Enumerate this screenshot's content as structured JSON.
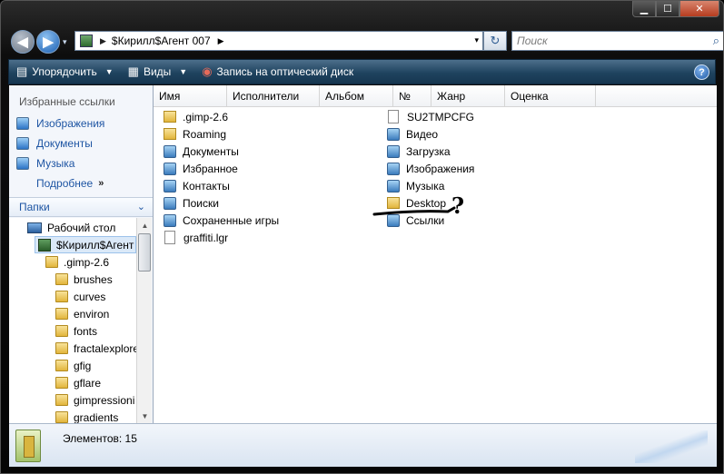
{
  "window": {
    "caption_buttons": {
      "minimize": "▁",
      "maximize": "☐",
      "close": "✕"
    }
  },
  "nav": {
    "back_glyph": "◀",
    "forward_glyph": "▶",
    "history_glyph": "▾"
  },
  "address": {
    "path": "$Кирилл$Агент 007",
    "separator_glyph": "▶",
    "dropdown_glyph": "▾"
  },
  "refresh": {
    "glyph": "↻"
  },
  "search": {
    "placeholder": "Поиск",
    "icon": "search-icon"
  },
  "toolbar": {
    "organize": "Упорядочить",
    "views": "Виды",
    "burn": "Запись на оптический диск",
    "help": "?",
    "chevron": "▼"
  },
  "favorites": {
    "header": "Избранные ссылки",
    "items": [
      {
        "label": "Изображения",
        "icon": "pictures-icon"
      },
      {
        "label": "Документы",
        "icon": "documents-icon"
      },
      {
        "label": "Музыка",
        "icon": "music-icon"
      }
    ],
    "more": "Подробнее",
    "more_chevron": "»"
  },
  "folders": {
    "header": "Папки",
    "chevron": "⌄",
    "tree": [
      {
        "label": "Рабочий стол",
        "type": "desktop"
      },
      {
        "label": "$Кирилл$Агент",
        "type": "user",
        "selected": true
      },
      {
        "label": ".gimp-2.6",
        "type": "folder"
      },
      {
        "label": "brushes",
        "type": "folder"
      },
      {
        "label": "curves",
        "type": "folder"
      },
      {
        "label": "environ",
        "type": "folder"
      },
      {
        "label": "fonts",
        "type": "folder"
      },
      {
        "label": "fractalexplore",
        "type": "folder"
      },
      {
        "label": "gfig",
        "type": "folder"
      },
      {
        "label": "gflare",
        "type": "folder"
      },
      {
        "label": "gimpressioni",
        "type": "folder"
      },
      {
        "label": "gradients",
        "type": "folder"
      }
    ]
  },
  "columns": [
    "Имя",
    "Исполнители",
    "Альбом",
    "№",
    "Жанр",
    "Оценка"
  ],
  "files_left": [
    {
      "name": ".gimp-2.6",
      "type": "folder"
    },
    {
      "name": "Roaming",
      "type": "folder"
    },
    {
      "name": "Документы",
      "type": "special"
    },
    {
      "name": "Избранное",
      "type": "special"
    },
    {
      "name": "Контакты",
      "type": "special"
    },
    {
      "name": "Поиски",
      "type": "special"
    },
    {
      "name": "Сохраненные игры",
      "type": "special"
    },
    {
      "name": "graffiti.lgr",
      "type": "doc"
    }
  ],
  "files_right": [
    {
      "name": "SU2TMPCFG",
      "type": "doc"
    },
    {
      "name": "Видео",
      "type": "special"
    },
    {
      "name": "Загрузка",
      "type": "special"
    },
    {
      "name": "Изображения",
      "type": "special"
    },
    {
      "name": "Музыка",
      "type": "special"
    },
    {
      "name": "Desktop",
      "type": "folder"
    },
    {
      "name": "Ссылки",
      "type": "special"
    }
  ],
  "annotation": {
    "mark": "?"
  },
  "status": {
    "items_count": "Элементов: 15"
  }
}
